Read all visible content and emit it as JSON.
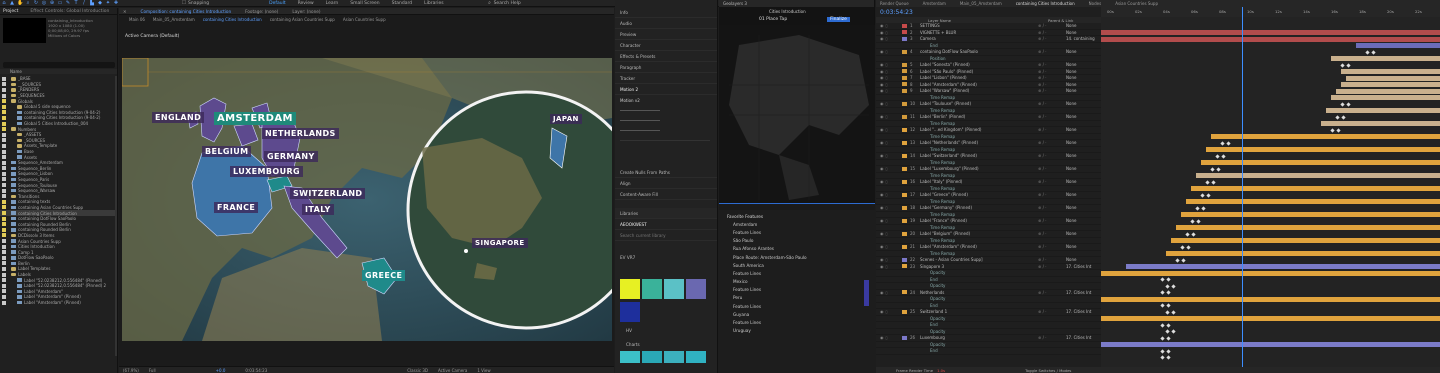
{
  "toolbar": {
    "workspaces": [
      "Default",
      "Review",
      "Learn",
      "Small Screen",
      "Standard",
      "Libraries"
    ],
    "active_workspace": "Default",
    "search": "Search Help",
    "snapping": "Snapping"
  },
  "project": {
    "tab": "Project",
    "tab2": "Effect Controls: Global Introduction",
    "info": [
      "containing_Introduction",
      "1920 x 1080 (1.00)",
      "0;00;08;00, 29.97 fps",
      "Millions of Colors",
      "None"
    ],
    "search_placeholder": "",
    "col_name": "Name",
    "items": [
      {
        "label": "_BASE",
        "kind": "folder",
        "color": "#c9c9c9"
      },
      {
        "label": "__SOURCES",
        "kind": "folder",
        "color": "#c9c9c9"
      },
      {
        "label": "_RENDERS",
        "kind": "folder",
        "color": "#c9c9c9"
      },
      {
        "label": "_SEQUENCES",
        "kind": "folder",
        "color": "#c9c9c9"
      },
      {
        "label": "Globals",
        "kind": "folder",
        "color": "#e2cc57"
      },
      {
        "label": "Global 5 side sequence",
        "kind": "folder",
        "color": "#e2cc57"
      },
      {
        "label": "containing Cities Introduction (9-04-2)",
        "kind": "comp",
        "color": "#e2cc57"
      },
      {
        "label": "containing Cities Introduction (9-04-2)",
        "kind": "comp",
        "color": "#e2cc57"
      },
      {
        "label": "Global 5 Cities Introduction_004",
        "kind": "comp",
        "color": "#e2cc57"
      },
      {
        "label": "Numbers",
        "kind": "folder",
        "color": "#e2cc57"
      },
      {
        "label": "_ASSETS",
        "kind": "folder",
        "color": "#c9c9c9"
      },
      {
        "label": "_SOURCES",
        "kind": "folder",
        "color": "#c9c9c9"
      },
      {
        "label": "Assets_Template",
        "kind": "folder",
        "color": "#c9c9c9"
      },
      {
        "label": "Base",
        "kind": "comp",
        "color": "#c9c9c9"
      },
      {
        "label": "Assets",
        "kind": "comp",
        "color": "#c9c9c9"
      },
      {
        "label": "Sequence_Amsterdam",
        "kind": "comp",
        "color": "#c9c9c9"
      },
      {
        "label": "Sequence_Berlin",
        "kind": "comp",
        "color": "#c9c9c9"
      },
      {
        "label": "Sequence_Lisbon",
        "kind": "comp",
        "color": "#c9c9c9"
      },
      {
        "label": "Sequence_Paris",
        "kind": "comp",
        "color": "#c9c9c9"
      },
      {
        "label": "Sequence_Toulouse",
        "kind": "comp",
        "color": "#c9c9c9"
      },
      {
        "label": "Sequence_Warsaw",
        "kind": "comp",
        "color": "#c9c9c9"
      },
      {
        "label": "Transitions",
        "kind": "folder",
        "color": "#c9c9c9"
      },
      {
        "label": "containing texts",
        "kind": "comp",
        "color": "#e2cc57"
      },
      {
        "label": "containing Asian Countries Supp",
        "kind": "comp",
        "color": "#e2cc57"
      },
      {
        "label": "containing Cities Introduction",
        "kind": "comp",
        "color": "#e2cc57"
      },
      {
        "label": "containing DotFlow SaoPaolo",
        "kind": "comp",
        "color": "#e2cc57"
      },
      {
        "label": "containing Rounded Berlin",
        "kind": "comp",
        "color": "#e2cc57"
      },
      {
        "label": "containing Rounded Berlin",
        "kind": "comp",
        "color": "#e2cc57"
      },
      {
        "label": "DCDissolv 3 Items",
        "kind": "folder",
        "color": "#e2cc57"
      },
      {
        "label": "Asian Countries Supp",
        "kind": "comp",
        "color": "#c9c9c9"
      },
      {
        "label": "Cities Introduction",
        "kind": "comp",
        "color": "#c9c9c9"
      },
      {
        "label": "Camp 1",
        "kind": "comp",
        "color": "#c9c9c9"
      },
      {
        "label": "DotFlow SaoPaolo",
        "kind": "comp",
        "color": "#c9c9c9"
      },
      {
        "label": "Berlin",
        "kind": "comp",
        "color": "#c9c9c9"
      },
      {
        "label": "Label Templates",
        "kind": "folder",
        "color": "#c9c9c9"
      },
      {
        "label": "Labels",
        "kind": "folder",
        "color": "#c9c9c9"
      },
      {
        "label": "Label \"52.0238212,0.556484\" (Pinned)",
        "kind": "comp",
        "color": "#c9c9c9"
      },
      {
        "label": "Label \"52.0238212,0.556484\" (Pinned) 2",
        "kind": "comp",
        "color": "#c9c9c9"
      },
      {
        "label": "Label \"Amsterdam\"",
        "kind": "comp",
        "color": "#c9c9c9"
      },
      {
        "label": "Label \"Amsterdam\" (Pinned)",
        "kind": "comp",
        "color": "#c9c9c9"
      },
      {
        "label": "Label \"Amsterdam\" (Pinned)",
        "kind": "comp",
        "color": "#c9c9c9"
      }
    ]
  },
  "viewer": {
    "tabs": [
      "Composition: containing Cities Introduction",
      "Footage: (none)",
      "Layer: (none)"
    ],
    "subtabs": [
      "Main 06",
      "Main_05_Amsterdam",
      "containing Cities Introduction",
      "containing Asian Countries Supp",
      "Asian Countries Supp"
    ],
    "camera_label": "Active Camera (Default)",
    "labels": {
      "england": "ENGLAND",
      "amsterdam": "AMSTERDAM",
      "netherlands": "NETHERLANDS",
      "belgium": "BELGIUM",
      "germany": "GERMANY",
      "luxembourg": "LUXEMBOURG",
      "france": "FRANCE",
      "switzerland": "SWITZERLAND",
      "italy": "ITALY",
      "greece": "GREECE",
      "japan": "JAPAN",
      "singapore": "SINGAPORE"
    },
    "footer": {
      "zoom": "(67.9%)",
      "quality": "Full",
      "time": "0:03:54:23",
      "renderer": "Classic 3D",
      "camera": "Active Camera",
      "views": "1 View",
      "exposure": "+0.0"
    }
  },
  "panels": {
    "items": [
      "Info",
      "Audio",
      "Preview",
      "Character",
      "Effects & Presets",
      "Paragraph",
      "Tracker",
      "Motion 2"
    ],
    "motion_preset": "Motion v2",
    "create_nulls": "Create Nulls From Paths",
    "align": "Align",
    "content_aware": "Content-Aware Fill",
    "libraries": "Libraries",
    "library_name": "AEOOKWEST",
    "search_placeholder": "Search current library",
    "group1": "EV VR7",
    "group2": "HV",
    "group3": "Charts",
    "colors1": [
      "#e7f023",
      "#3ab29a",
      "#5bc1c6",
      "#6a68b0",
      "#1e2f9c"
    ],
    "colors2": [
      "#3cc0c8",
      "#2aa8b6",
      "#3cb0be",
      "#30b2c2"
    ]
  },
  "mapview": {
    "tab": "Geolayers 3",
    "comp_label": "Cities Introduction",
    "map_label": "01 Place Tap",
    "finalize": "Finalize",
    "feature_header": "Favorite Features",
    "features": [
      "Amsterdam",
      "Feature Lines",
      "São Paulo",
      "Rua Afonso Arantes",
      "Place Route: Amsterdam-São Paulo",
      "South America",
      "Feature Lines",
      "Mexico",
      "Feature Lines",
      "Peru",
      "Feature Lines",
      "Guyana",
      "Feature Lines",
      "Uruguay"
    ]
  },
  "timeline": {
    "time": "0:03:54:23",
    "tabs": [
      "Render Queue",
      "Amsterdam",
      "Main_05_Amsterdam",
      "containing Cities Introduction",
      "Nodes",
      "Asian Countries Supp"
    ],
    "col_layer": "Layer Name",
    "col_parent": "Parent & Link",
    "layers": [
      {
        "num": "1",
        "name": "SETTINGS",
        "color": "#c64a4a",
        "parent": "None",
        "bar": "#b24c4c"
      },
      {
        "num": "2",
        "name": "VIGNETTE + BLUR",
        "color": "#c64a4a",
        "parent": "None",
        "bar": "#b24c4c"
      },
      {
        "num": "3",
        "name": "Camera",
        "color": "#7b78c8",
        "parent": "14. containing",
        "bar": "#6c6cb8"
      },
      {
        "num": "",
        "name": "End",
        "color": "",
        "parent": "",
        "bar": ""
      },
      {
        "num": "4",
        "name": "containing DotFlow SaoPaolo",
        "color": "#d29a3b",
        "parent": "None",
        "bar": "#c9b08d"
      },
      {
        "num": "",
        "name": "Position",
        "color": "",
        "parent": "",
        "bar": ""
      },
      {
        "num": "5",
        "name": "Label \"Sonesta\" (Pinned)",
        "color": "#d29a3b",
        "parent": "None",
        "bar": "#c9b08d"
      },
      {
        "num": "6",
        "name": "Label \"São Paulo\" (Pinned)",
        "color": "#d29a3b",
        "parent": "None",
        "bar": "#c9b08d"
      },
      {
        "num": "7",
        "name": "Label \"Lisbon\" (Pinned)",
        "color": "#d29a3b",
        "parent": "None",
        "bar": "#c9b08d"
      },
      {
        "num": "8",
        "name": "Label \"Amsterdam\" (Pinned)",
        "color": "#d29a3b",
        "parent": "None",
        "bar": "#c9b08d"
      },
      {
        "num": "9",
        "name": "Label \"Warsaw\" (Pinned)",
        "color": "#d29a3b",
        "parent": "None",
        "bar": "#c9b08d"
      },
      {
        "num": "",
        "name": "Time Remap",
        "color": "",
        "parent": "",
        "bar": ""
      },
      {
        "num": "10",
        "name": "Label \"Toulouse\" (Pinned)",
        "color": "#d29a3b",
        "parent": "None",
        "bar": "#c9b08d"
      },
      {
        "num": "",
        "name": "Time Remap",
        "color": "",
        "parent": "",
        "bar": ""
      },
      {
        "num": "11",
        "name": "Label \"Berlin\" (Pinned)",
        "color": "#d29a3b",
        "parent": "None",
        "bar": "#c9b08d"
      },
      {
        "num": "",
        "name": "Time Remap",
        "color": "",
        "parent": "",
        "bar": ""
      },
      {
        "num": "12",
        "name": "Label \"...ed Kingdom\" (Pinned)",
        "color": "#e0a33d",
        "parent": "None",
        "bar": "#e0a33d"
      },
      {
        "num": "",
        "name": "Time Remap",
        "color": "",
        "parent": "",
        "bar": ""
      },
      {
        "num": "13",
        "name": "Label \"Netherlands\" (Pinned)",
        "color": "#e0a33d",
        "parent": "None",
        "bar": "#e0a33d"
      },
      {
        "num": "",
        "name": "Time Remap",
        "color": "",
        "parent": "",
        "bar": ""
      },
      {
        "num": "14",
        "name": "Label \"Switzerland\" (Pinned)",
        "color": "#e0a33d",
        "parent": "None",
        "bar": "#e0a33d"
      },
      {
        "num": "",
        "name": "Time Remap",
        "color": "",
        "parent": "",
        "bar": ""
      },
      {
        "num": "15",
        "name": "Label \"Luxembourg\" (Pinned)",
        "color": "#e0a33d",
        "parent": "None",
        "bar": "#c9b08d"
      },
      {
        "num": "",
        "name": "Time Remap",
        "color": "",
        "parent": "",
        "bar": ""
      },
      {
        "num": "16",
        "name": "Label \"Italy\" (Pinned)",
        "color": "#e0a33d",
        "parent": "None",
        "bar": "#e0a33d"
      },
      {
        "num": "",
        "name": "Time Remap",
        "color": "",
        "parent": "",
        "bar": ""
      },
      {
        "num": "17",
        "name": "Label \"Greece\" (Pinned)",
        "color": "#e0a33d",
        "parent": "None",
        "bar": "#e0a33d"
      },
      {
        "num": "",
        "name": "Time Remap",
        "color": "",
        "parent": "",
        "bar": ""
      },
      {
        "num": "18",
        "name": "Label \"Germany\" (Pinned)",
        "color": "#e0a33d",
        "parent": "None",
        "bar": "#e0a33d"
      },
      {
        "num": "",
        "name": "Time Remap",
        "color": "",
        "parent": "",
        "bar": ""
      },
      {
        "num": "19",
        "name": "Label \"France\" (Pinned)",
        "color": "#e0a33d",
        "parent": "None",
        "bar": "#e0a33d"
      },
      {
        "num": "",
        "name": "Time Remap",
        "color": "",
        "parent": "",
        "bar": ""
      },
      {
        "num": "20",
        "name": "Label \"Belgium\" (Pinned)",
        "color": "#e0a33d",
        "parent": "None",
        "bar": "#e0a33d"
      },
      {
        "num": "",
        "name": "Time Remap",
        "color": "",
        "parent": "",
        "bar": ""
      },
      {
        "num": "21",
        "name": "Label \"Amsterdam\" (Pinned)",
        "color": "#e0a33d",
        "parent": "None",
        "bar": "#e0a33d"
      },
      {
        "num": "",
        "name": "Time Remap",
        "color": "",
        "parent": "",
        "bar": ""
      },
      {
        "num": "22",
        "name": "Scenes - Asian Countries Supp]",
        "color": "#7b78c8",
        "parent": "None",
        "bar": "#7b7bc8"
      },
      {
        "num": "23",
        "name": "Singapore 3",
        "color": "#e0a33d",
        "parent": "17. Cities Int",
        "bar": "#e0a33d"
      },
      {
        "num": "",
        "name": "Opacity",
        "color": "",
        "parent": "",
        "bar": ""
      },
      {
        "num": "",
        "name": "End",
        "color": "",
        "parent": "",
        "bar": ""
      },
      {
        "num": "",
        "name": "Opacity",
        "color": "",
        "parent": "",
        "bar": ""
      },
      {
        "num": "24",
        "name": "Netherlands",
        "color": "#e0a33d",
        "parent": "17. Cities Int",
        "bar": "#e0a33d"
      },
      {
        "num": "",
        "name": "Opacity",
        "color": "",
        "parent": "",
        "bar": ""
      },
      {
        "num": "",
        "name": "End",
        "color": "",
        "parent": "",
        "bar": ""
      },
      {
        "num": "25",
        "name": "Switzerland 1",
        "color": "#e0a33d",
        "parent": "17. Cities Int",
        "bar": "#e0a33d"
      },
      {
        "num": "",
        "name": "Opacity",
        "color": "",
        "parent": "",
        "bar": ""
      },
      {
        "num": "",
        "name": "End",
        "color": "",
        "parent": "",
        "bar": ""
      },
      {
        "num": "",
        "name": "Opacity",
        "color": "",
        "parent": "",
        "bar": ""
      },
      {
        "num": "26",
        "name": "Luxembourg",
        "color": "#7b78c8",
        "parent": "17. Cities Int",
        "bar": "#7b7bc8"
      },
      {
        "num": "",
        "name": "Opacity",
        "color": "",
        "parent": "",
        "bar": ""
      },
      {
        "num": "",
        "name": "End",
        "color": "",
        "parent": "",
        "bar": ""
      }
    ],
    "ruler": [
      "00s",
      "02s",
      "04s",
      "06s",
      "08s",
      "10s",
      "12s",
      "14s",
      "16s",
      "18s",
      "20s",
      "22s"
    ],
    "footer": "Frame Render Time",
    "footer_value": "1.0s",
    "footer2": "Toggle Switches / Modes"
  }
}
